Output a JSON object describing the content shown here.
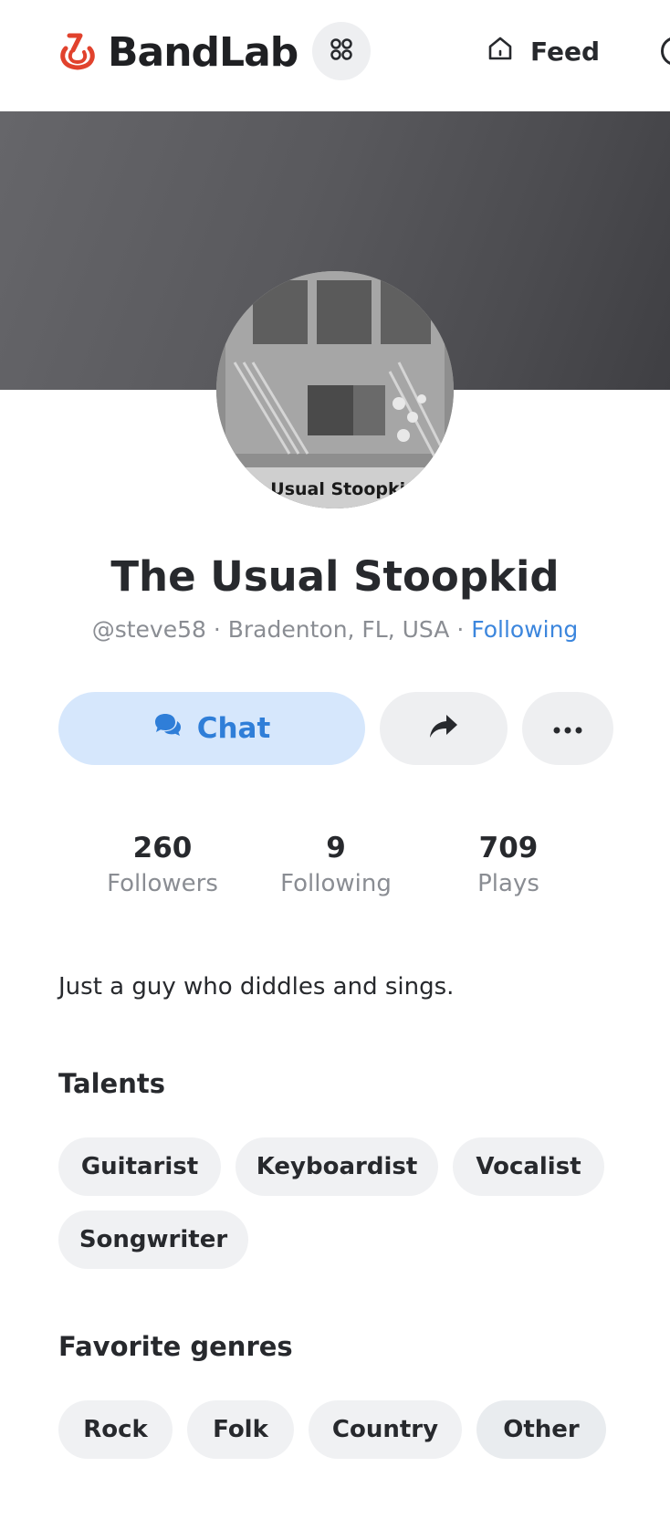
{
  "header": {
    "brand": "BandLab",
    "feed_label": "Feed"
  },
  "profile": {
    "name": "The Usual Stoopkid",
    "handle": "@steve58",
    "separator": " · ",
    "location": "Bradenton, FL, USA",
    "follow_status": "Following",
    "avatar_caption": "Usual Stoopkid"
  },
  "actions": {
    "chat_label": "Chat"
  },
  "stats": [
    {
      "value": "260",
      "label": "Followers"
    },
    {
      "value": "9",
      "label": "Following"
    },
    {
      "value": "709",
      "label": "Plays"
    }
  ],
  "bio": "Just a guy who diddles and sings.",
  "talents": {
    "title": "Talents",
    "items": [
      "Guitarist",
      "Keyboardist",
      "Vocalist",
      "Songwriter"
    ]
  },
  "genres": {
    "title": "Favorite genres",
    "items": [
      "Rock",
      "Folk",
      "Country",
      "Other"
    ]
  },
  "colors": {
    "brand": "#e1422d",
    "link": "#3c86dd",
    "chat_bg": "#d6e7fc",
    "chip_bg": "#f0f1f3"
  },
  "icons": [
    "bandlab-logo-icon",
    "apps-grid-icon",
    "home-icon",
    "chat-bubbles-icon",
    "share-arrow-icon",
    "more-dots-icon"
  ]
}
